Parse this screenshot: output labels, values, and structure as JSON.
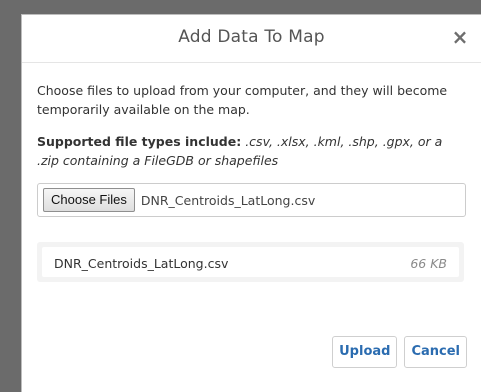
{
  "dialog": {
    "title": "Add Data To Map",
    "close_label": "×",
    "intro": "Choose files to upload from your computer, and they will become temporarily available on the map.",
    "supported_lead": "Supported file types include:",
    "supported_types": " .csv, .xlsx, .kml, .shp, .gpx, or a .zip containing a FileGDB or shapefiles",
    "file_input": {
      "button_label": "Choose Files",
      "chosen_filename": "DNR_Centroids_LatLong.csv"
    },
    "files": [
      {
        "name": "DNR_Centroids_LatLong.csv",
        "size": "66 KB"
      }
    ],
    "buttons": {
      "upload": "Upload",
      "cancel": "Cancel"
    }
  },
  "colors": {
    "accent": "#2b6cb0",
    "title": "#555555"
  },
  "icons": {
    "close": "close-icon"
  }
}
